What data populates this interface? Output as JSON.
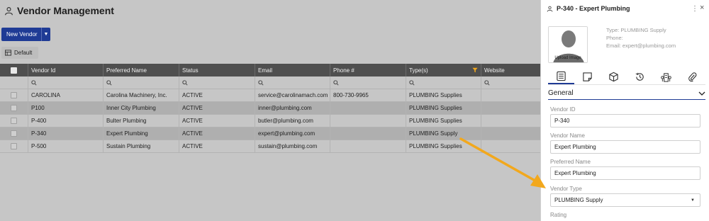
{
  "header": {
    "title": "Vendor Management",
    "icon": "vendor-user-icon"
  },
  "toolbar": {
    "new_vendor_label": "New Vendor",
    "view_label": "Default"
  },
  "grid": {
    "columns": [
      "Vendor Id",
      "Preferred Name",
      "Status",
      "Email",
      "Phone #",
      "Type(s)",
      "Website"
    ],
    "rows": [
      {
        "id": "CAROLINA",
        "name": "Carolina Machinery, Inc.",
        "status": "ACTIVE",
        "email": "service@carolinamach.com",
        "phone": "800-730-9965",
        "type": "PLUMBING Supplies",
        "website": ""
      },
      {
        "id": "P100",
        "name": "Inner City Plumbing",
        "status": "ACTIVE",
        "email": "inner@plumbing.com",
        "phone": "",
        "type": "PLUMBING Supplies",
        "website": ""
      },
      {
        "id": "P-400",
        "name": "Bulter Plumbing",
        "status": "ACTIVE",
        "email": "butler@plumbing.com",
        "phone": "",
        "type": "PLUMBING Supplies",
        "website": ""
      },
      {
        "id": "P-340",
        "name": "Expert Plumbing",
        "status": "ACTIVE",
        "email": "expert@plumbing.com",
        "phone": "",
        "type": "PLUMBING Supply",
        "website": ""
      },
      {
        "id": "P-500",
        "name": "Sustain Plumbing",
        "status": "ACTIVE",
        "email": "sustain@plumbing.com",
        "phone": "",
        "type": "PLUMBING Supplies",
        "website": ""
      }
    ]
  },
  "panel": {
    "title": "P-340 - Expert Plumbing",
    "upload_label": "Upload Image",
    "meta_type": "Type: PLUMBING Supply",
    "meta_phone": "Phone:",
    "meta_email": "Email: expert@plumbing.com",
    "section_label": "General",
    "vendor_id_label": "Vendor ID",
    "vendor_id_value": "P-340",
    "vendor_name_label": "Vendor Name",
    "vendor_name_value": "Expert Plumbing",
    "preferred_name_label": "Preferred Name",
    "preferred_name_value": "Expert Plumbing",
    "vendor_type_label": "Vendor Type",
    "vendor_type_value": "PLUMBING Supply",
    "rating_label": "Rating"
  },
  "colors": {
    "primary": "#1f3b95",
    "arrow": "#f2a81d",
    "header_bg": "#4f4f4f"
  }
}
